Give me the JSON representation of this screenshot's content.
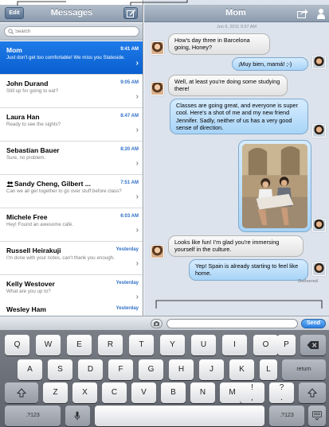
{
  "master": {
    "edit_label": "Edit",
    "title": "Messages",
    "search_placeholder": "Search",
    "conversations": [
      {
        "name": "Mom",
        "time": "9:41 AM",
        "preview": "Just don't get too comfortable! We miss you Stateside."
      },
      {
        "name": "John Durand",
        "time": "9:05 AM",
        "preview": "Still up for going to eat?"
      },
      {
        "name": "Laura Han",
        "time": "8:47 AM",
        "preview": "Ready to see the sights?"
      },
      {
        "name": "Sebastian Bauer",
        "time": "8:20 AM",
        "preview": "Sure, no problem."
      },
      {
        "name": "Sandy Cheng, Gilbert ...",
        "time": "7:51 AM",
        "preview": "Can we all get together to go over stuff before class?"
      },
      {
        "name": "Michele Free",
        "time": "6:03 AM",
        "preview": "Hey! Found an awesome café."
      },
      {
        "name": "Russell Heirakuji",
        "time": "Yesterday",
        "preview": "I'm done with your notes, can't thank you enough."
      },
      {
        "name": "Kelly Westover",
        "time": "Yesterday",
        "preview": "What are you up to?"
      },
      {
        "name": "Wesley Ham",
        "time": "Yesterday",
        "preview": ""
      }
    ]
  },
  "detail": {
    "title": "Mom",
    "timestamp": "Jun 6, 2011 9:37 AM",
    "messages": [
      {
        "from": "in",
        "text": "How's day three in Barcelona going, Honey?"
      },
      {
        "from": "out",
        "text": "¡Muy bien, mamá! ;-)"
      },
      {
        "from": "in",
        "text": "Well, at least you're doing some studying there!"
      },
      {
        "from": "out",
        "text": "Classes are going great, and everyone is super cool. Here's a shot of me and my new friend Jennifer. Sadly, neither of us has a very good sense of direction."
      },
      {
        "from": "in",
        "text": "Looks like fun! I'm glad you're immersing yourself in the culture."
      },
      {
        "from": "out",
        "text": "Yep! Spain is already starting to feel like home."
      }
    ],
    "delivered": "Delivered"
  },
  "input": {
    "send_label": "Send",
    "message_value": ""
  },
  "keyboard": {
    "row1": [
      "Q",
      "W",
      "E",
      "R",
      "T",
      "Y",
      "U",
      "I",
      "O",
      "P"
    ],
    "row2": [
      "A",
      "S",
      "D",
      "F",
      "G",
      "H",
      "J",
      "K",
      "L"
    ],
    "return_label": "return",
    "row3": [
      "Z",
      "X",
      "C",
      "V",
      "B",
      "N",
      "M",
      "!",
      "?"
    ],
    "row3_sub": {
      "excl": ",",
      "quest": "."
    },
    "numbers_label": ".?123"
  },
  "colors": {
    "accent": "#0a5fd0",
    "outgoing_bubble": "#a8d4f7",
    "incoming_bubble": "#e2e2e2",
    "send": "#2a7fe0"
  },
  "icons": [
    "search-icon",
    "compose-icon",
    "forward-icon",
    "contact-icon",
    "camera-icon",
    "microphone-icon",
    "keyboard-dismiss-icon",
    "shift-icon",
    "backspace-icon",
    "chevron-right-icon",
    "group-icon"
  ]
}
